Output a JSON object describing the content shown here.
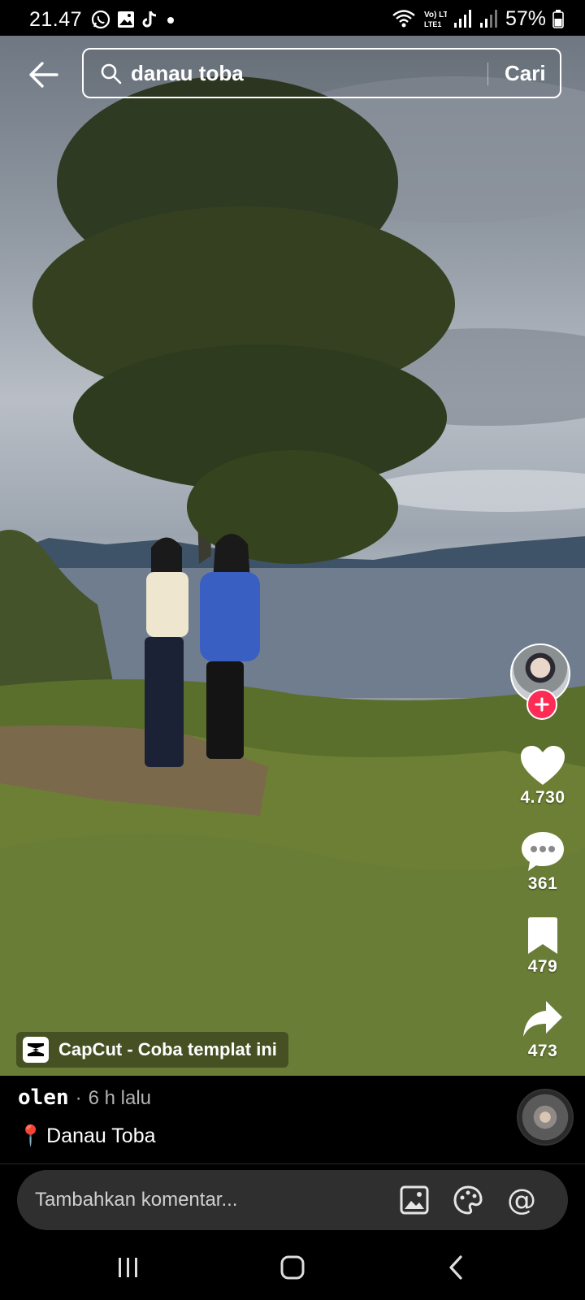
{
  "status_bar": {
    "time": "21.47",
    "battery_percent": "57%",
    "notification_icons": [
      "whatsapp-icon",
      "gallery-icon",
      "tiktok-icon",
      "dot-icon"
    ],
    "system_icons": [
      "wifi-icon",
      "volte-icon",
      "signal-icon",
      "signal-icon",
      "battery-icon"
    ],
    "network_label": "Vo) LTE1"
  },
  "search": {
    "query": "danau toba",
    "submit_label": "Cari"
  },
  "actions": {
    "likes": "4.730",
    "comments": "361",
    "saves": "479",
    "shares": "473"
  },
  "capcut": {
    "label": "CapCut - Coba templat ini"
  },
  "post": {
    "author": "olen",
    "separator": "·",
    "time_ago": "6 h lalu",
    "location_pin": "📍",
    "description": "Danau Toba"
  },
  "comment_bar": {
    "placeholder": "Tambahkan komentar...",
    "mention_symbol": "@"
  },
  "colors": {
    "follow_accent": "#fe2c55",
    "background": "#000000"
  }
}
